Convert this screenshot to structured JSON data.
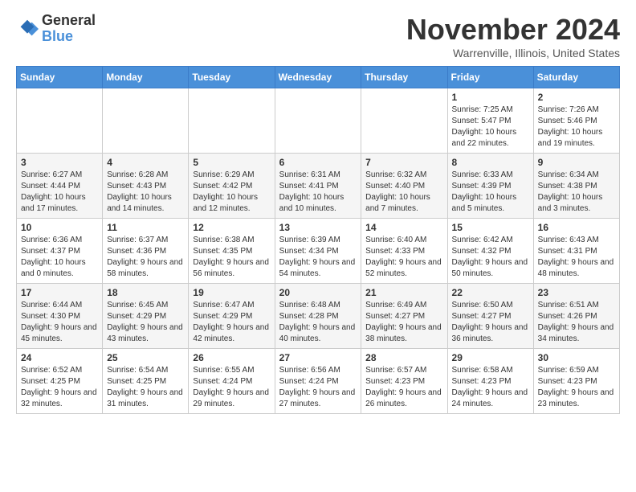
{
  "logo": {
    "general": "General",
    "blue": "Blue"
  },
  "header": {
    "month_year": "November 2024",
    "location": "Warrenville, Illinois, United States"
  },
  "weekdays": [
    "Sunday",
    "Monday",
    "Tuesday",
    "Wednesday",
    "Thursday",
    "Friday",
    "Saturday"
  ],
  "weeks": [
    [
      {
        "day": "",
        "info": ""
      },
      {
        "day": "",
        "info": ""
      },
      {
        "day": "",
        "info": ""
      },
      {
        "day": "",
        "info": ""
      },
      {
        "day": "",
        "info": ""
      },
      {
        "day": "1",
        "info": "Sunrise: 7:25 AM\nSunset: 5:47 PM\nDaylight: 10 hours and 22 minutes."
      },
      {
        "day": "2",
        "info": "Sunrise: 7:26 AM\nSunset: 5:46 PM\nDaylight: 10 hours and 19 minutes."
      }
    ],
    [
      {
        "day": "3",
        "info": "Sunrise: 6:27 AM\nSunset: 4:44 PM\nDaylight: 10 hours and 17 minutes."
      },
      {
        "day": "4",
        "info": "Sunrise: 6:28 AM\nSunset: 4:43 PM\nDaylight: 10 hours and 14 minutes."
      },
      {
        "day": "5",
        "info": "Sunrise: 6:29 AM\nSunset: 4:42 PM\nDaylight: 10 hours and 12 minutes."
      },
      {
        "day": "6",
        "info": "Sunrise: 6:31 AM\nSunset: 4:41 PM\nDaylight: 10 hours and 10 minutes."
      },
      {
        "day": "7",
        "info": "Sunrise: 6:32 AM\nSunset: 4:40 PM\nDaylight: 10 hours and 7 minutes."
      },
      {
        "day": "8",
        "info": "Sunrise: 6:33 AM\nSunset: 4:39 PM\nDaylight: 10 hours and 5 minutes."
      },
      {
        "day": "9",
        "info": "Sunrise: 6:34 AM\nSunset: 4:38 PM\nDaylight: 10 hours and 3 minutes."
      }
    ],
    [
      {
        "day": "10",
        "info": "Sunrise: 6:36 AM\nSunset: 4:37 PM\nDaylight: 10 hours and 0 minutes."
      },
      {
        "day": "11",
        "info": "Sunrise: 6:37 AM\nSunset: 4:36 PM\nDaylight: 9 hours and 58 minutes."
      },
      {
        "day": "12",
        "info": "Sunrise: 6:38 AM\nSunset: 4:35 PM\nDaylight: 9 hours and 56 minutes."
      },
      {
        "day": "13",
        "info": "Sunrise: 6:39 AM\nSunset: 4:34 PM\nDaylight: 9 hours and 54 minutes."
      },
      {
        "day": "14",
        "info": "Sunrise: 6:40 AM\nSunset: 4:33 PM\nDaylight: 9 hours and 52 minutes."
      },
      {
        "day": "15",
        "info": "Sunrise: 6:42 AM\nSunset: 4:32 PM\nDaylight: 9 hours and 50 minutes."
      },
      {
        "day": "16",
        "info": "Sunrise: 6:43 AM\nSunset: 4:31 PM\nDaylight: 9 hours and 48 minutes."
      }
    ],
    [
      {
        "day": "17",
        "info": "Sunrise: 6:44 AM\nSunset: 4:30 PM\nDaylight: 9 hours and 45 minutes."
      },
      {
        "day": "18",
        "info": "Sunrise: 6:45 AM\nSunset: 4:29 PM\nDaylight: 9 hours and 43 minutes."
      },
      {
        "day": "19",
        "info": "Sunrise: 6:47 AM\nSunset: 4:29 PM\nDaylight: 9 hours and 42 minutes."
      },
      {
        "day": "20",
        "info": "Sunrise: 6:48 AM\nSunset: 4:28 PM\nDaylight: 9 hours and 40 minutes."
      },
      {
        "day": "21",
        "info": "Sunrise: 6:49 AM\nSunset: 4:27 PM\nDaylight: 9 hours and 38 minutes."
      },
      {
        "day": "22",
        "info": "Sunrise: 6:50 AM\nSunset: 4:27 PM\nDaylight: 9 hours and 36 minutes."
      },
      {
        "day": "23",
        "info": "Sunrise: 6:51 AM\nSunset: 4:26 PM\nDaylight: 9 hours and 34 minutes."
      }
    ],
    [
      {
        "day": "24",
        "info": "Sunrise: 6:52 AM\nSunset: 4:25 PM\nDaylight: 9 hours and 32 minutes."
      },
      {
        "day": "25",
        "info": "Sunrise: 6:54 AM\nSunset: 4:25 PM\nDaylight: 9 hours and 31 minutes."
      },
      {
        "day": "26",
        "info": "Sunrise: 6:55 AM\nSunset: 4:24 PM\nDaylight: 9 hours and 29 minutes."
      },
      {
        "day": "27",
        "info": "Sunrise: 6:56 AM\nSunset: 4:24 PM\nDaylight: 9 hours and 27 minutes."
      },
      {
        "day": "28",
        "info": "Sunrise: 6:57 AM\nSunset: 4:23 PM\nDaylight: 9 hours and 26 minutes."
      },
      {
        "day": "29",
        "info": "Sunrise: 6:58 AM\nSunset: 4:23 PM\nDaylight: 9 hours and 24 minutes."
      },
      {
        "day": "30",
        "info": "Sunrise: 6:59 AM\nSunset: 4:23 PM\nDaylight: 9 hours and 23 minutes."
      }
    ]
  ]
}
